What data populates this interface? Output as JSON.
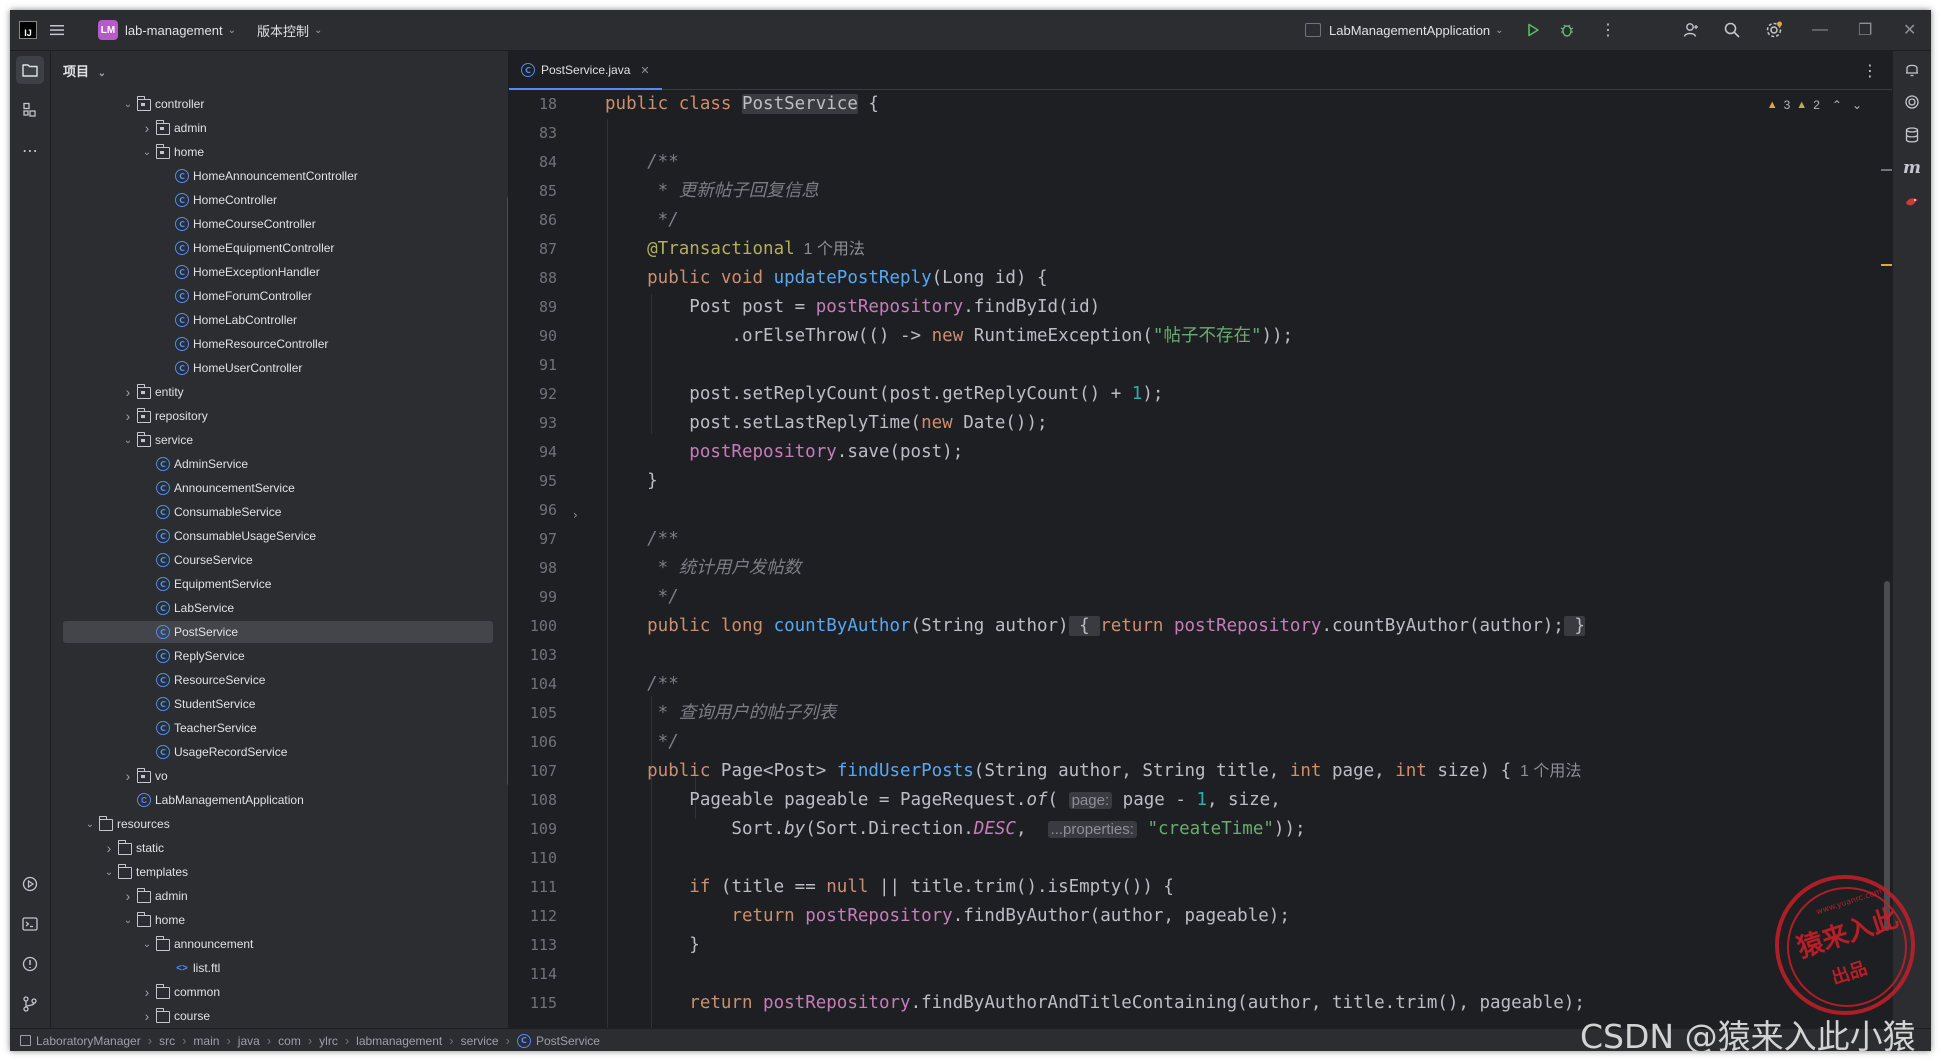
{
  "titlebar": {
    "project_badge": "LM",
    "project_name": "lab-management",
    "vcs_label": "版本控制",
    "run_config": "LabManagementApplication"
  },
  "project_panel": {
    "title": "项目",
    "tree": [
      {
        "label": "controller",
        "depth": 3,
        "type": "package",
        "expanded": true
      },
      {
        "label": "admin",
        "depth": 4,
        "type": "package",
        "expanded": false
      },
      {
        "label": "home",
        "depth": 4,
        "type": "package",
        "expanded": true
      },
      {
        "label": "HomeAnnouncementController",
        "depth": 5,
        "type": "class"
      },
      {
        "label": "HomeController",
        "depth": 5,
        "type": "class"
      },
      {
        "label": "HomeCourseController",
        "depth": 5,
        "type": "class"
      },
      {
        "label": "HomeEquipmentController",
        "depth": 5,
        "type": "class"
      },
      {
        "label": "HomeExceptionHandler",
        "depth": 5,
        "type": "class"
      },
      {
        "label": "HomeForumController",
        "depth": 5,
        "type": "class"
      },
      {
        "label": "HomeLabController",
        "depth": 5,
        "type": "class"
      },
      {
        "label": "HomeResourceController",
        "depth": 5,
        "type": "class"
      },
      {
        "label": "HomeUserController",
        "depth": 5,
        "type": "class"
      },
      {
        "label": "entity",
        "depth": 3,
        "type": "package",
        "expanded": false
      },
      {
        "label": "repository",
        "depth": 3,
        "type": "package",
        "expanded": false
      },
      {
        "label": "service",
        "depth": 3,
        "type": "package",
        "expanded": true
      },
      {
        "label": "AdminService",
        "depth": 4,
        "type": "class"
      },
      {
        "label": "AnnouncementService",
        "depth": 4,
        "type": "class"
      },
      {
        "label": "ConsumableService",
        "depth": 4,
        "type": "class"
      },
      {
        "label": "ConsumableUsageService",
        "depth": 4,
        "type": "class"
      },
      {
        "label": "CourseService",
        "depth": 4,
        "type": "class"
      },
      {
        "label": "EquipmentService",
        "depth": 4,
        "type": "class"
      },
      {
        "label": "LabService",
        "depth": 4,
        "type": "class"
      },
      {
        "label": "PostService",
        "depth": 4,
        "type": "class",
        "selected": true
      },
      {
        "label": "ReplyService",
        "depth": 4,
        "type": "class"
      },
      {
        "label": "ResourceService",
        "depth": 4,
        "type": "class"
      },
      {
        "label": "StudentService",
        "depth": 4,
        "type": "class"
      },
      {
        "label": "TeacherService",
        "depth": 4,
        "type": "class"
      },
      {
        "label": "UsageRecordService",
        "depth": 4,
        "type": "class"
      },
      {
        "label": "vo",
        "depth": 3,
        "type": "package",
        "expanded": false
      },
      {
        "label": "LabManagementApplication",
        "depth": 3,
        "type": "app"
      },
      {
        "label": "resources",
        "depth": 1,
        "type": "folder",
        "expanded": true
      },
      {
        "label": "static",
        "depth": 2,
        "type": "folder",
        "expanded": false
      },
      {
        "label": "templates",
        "depth": 2,
        "type": "folder",
        "expanded": true
      },
      {
        "label": "admin",
        "depth": 3,
        "type": "folder",
        "expanded": false
      },
      {
        "label": "home",
        "depth": 3,
        "type": "folder",
        "expanded": true
      },
      {
        "label": "announcement",
        "depth": 4,
        "type": "folder",
        "expanded": true
      },
      {
        "label": "list.ftl",
        "depth": 5,
        "type": "ftl"
      },
      {
        "label": "common",
        "depth": 4,
        "type": "folder",
        "expanded": false
      },
      {
        "label": "course",
        "depth": 4,
        "type": "folder",
        "expanded": false
      }
    ]
  },
  "editor": {
    "tab_label": "PostService.java",
    "warnings": "3",
    "weak_warnings": "2",
    "sticky": {
      "ln": "18",
      "tokens": [
        [
          "kw",
          "public class "
        ],
        [
          "hlname",
          "PostService"
        ],
        [
          "t",
          " {"
        ]
      ]
    },
    "lines": [
      {
        "ln": "83",
        "tokens": []
      },
      {
        "ln": "84",
        "tokens": [
          [
            "cmt",
            "    /**"
          ]
        ]
      },
      {
        "ln": "85",
        "tokens": [
          [
            "cmt",
            "     * 更新帖子回复信息"
          ]
        ]
      },
      {
        "ln": "86",
        "tokens": [
          [
            "cmt",
            "     */"
          ]
        ]
      },
      {
        "ln": "87",
        "tokens": [
          [
            "ann",
            "    @Transactional"
          ],
          [
            "usage",
            "  1 个用法"
          ]
        ]
      },
      {
        "ln": "88",
        "tokens": [
          [
            "kw",
            "    public void "
          ],
          [
            "fn",
            "updatePostReply"
          ],
          [
            "t",
            "(Long id) {"
          ]
        ]
      },
      {
        "ln": "89",
        "tokens": [
          [
            "t",
            "        Post post = "
          ],
          [
            "fld",
            "postRepository"
          ],
          [
            "t",
            ".findById(id)"
          ]
        ]
      },
      {
        "ln": "90",
        "tokens": [
          [
            "t",
            "            .orElseThrow(() -> "
          ],
          [
            "kw",
            "new "
          ],
          [
            "t",
            "RuntimeException("
          ],
          [
            "str",
            "\"帖子不存在\""
          ],
          [
            "t",
            "));"
          ]
        ]
      },
      {
        "ln": "91",
        "tokens": []
      },
      {
        "ln": "92",
        "tokens": [
          [
            "t",
            "        post.setReplyCount(post.getReplyCount() + "
          ],
          [
            "num",
            "1"
          ],
          [
            "t",
            ");"
          ]
        ]
      },
      {
        "ln": "93",
        "tokens": [
          [
            "t",
            "        post.setLastReplyTime("
          ],
          [
            "kw",
            "new "
          ],
          [
            "t",
            "Date());"
          ]
        ]
      },
      {
        "ln": "94",
        "tokens": [
          [
            "fld",
            "        postRepository"
          ],
          [
            "t",
            ".save(post);"
          ]
        ]
      },
      {
        "ln": "95",
        "tokens": [
          [
            "t",
            "    }"
          ]
        ]
      },
      {
        "ln": "96",
        "tokens": []
      },
      {
        "ln": "97",
        "tokens": [
          [
            "cmt",
            "    /**"
          ]
        ]
      },
      {
        "ln": "98",
        "tokens": [
          [
            "cmt",
            "     * 统计用户发帖数"
          ]
        ]
      },
      {
        "ln": "99",
        "tokens": [
          [
            "cmt",
            "     */"
          ]
        ]
      },
      {
        "ln": "100",
        "tokens": [
          [
            "kw",
            "    public long "
          ],
          [
            "fn",
            "countByAuthor"
          ],
          [
            "t",
            "(String author)"
          ],
          [
            "fold",
            " { "
          ],
          [
            "kw",
            "return "
          ],
          [
            "fld",
            "postRepository"
          ],
          [
            "t",
            ".countByAuthor(author);"
          ],
          [
            "fold",
            " }"
          ]
        ]
      },
      {
        "ln": "103",
        "tokens": []
      },
      {
        "ln": "104",
        "tokens": [
          [
            "cmt",
            "    /**"
          ]
        ]
      },
      {
        "ln": "105",
        "tokens": [
          [
            "cmt",
            "     * 查询用户的帖子列表"
          ]
        ]
      },
      {
        "ln": "106",
        "tokens": [
          [
            "cmt",
            "     */"
          ]
        ]
      },
      {
        "ln": "107",
        "tokens": [
          [
            "kw",
            "    public "
          ],
          [
            "t",
            "Page<Post> "
          ],
          [
            "fn",
            "findUserPosts"
          ],
          [
            "t",
            "(String author, String title, "
          ],
          [
            "kw",
            "int "
          ],
          [
            "t",
            "page, "
          ],
          [
            "kw",
            "int "
          ],
          [
            "t",
            "size) {"
          ],
          [
            "usage",
            "  1 个用法"
          ]
        ]
      },
      {
        "ln": "108",
        "tokens": [
          [
            "t",
            "        Pageable pageable = PageRequest."
          ],
          [
            "it",
            "of"
          ],
          [
            "t",
            "( "
          ],
          [
            "hint",
            "page:"
          ],
          [
            "t",
            " page - "
          ],
          [
            "num",
            "1"
          ],
          [
            "t",
            ", size,"
          ]
        ]
      },
      {
        "ln": "109",
        "tokens": [
          [
            "t",
            "            Sort."
          ],
          [
            "it",
            "by"
          ],
          [
            "t",
            "(Sort.Direction."
          ],
          [
            "itfld",
            "DESC"
          ],
          [
            "t",
            ",  "
          ],
          [
            "hint",
            "...properties:"
          ],
          [
            "t",
            " "
          ],
          [
            "str",
            "\"createTime\""
          ],
          [
            "t",
            "));"
          ]
        ]
      },
      {
        "ln": "110",
        "tokens": []
      },
      {
        "ln": "111",
        "tokens": [
          [
            "kw",
            "        if "
          ],
          [
            "t",
            "(title == "
          ],
          [
            "kw",
            "null "
          ],
          [
            "t",
            "|| title.trim().isEmpty()) {"
          ]
        ]
      },
      {
        "ln": "112",
        "tokens": [
          [
            "kw",
            "            return "
          ],
          [
            "fld",
            "postRepository"
          ],
          [
            "t",
            ".findByAuthor(author, pageable);"
          ]
        ]
      },
      {
        "ln": "113",
        "tokens": [
          [
            "t",
            "        }"
          ]
        ]
      },
      {
        "ln": "114",
        "tokens": []
      },
      {
        "ln": "115",
        "tokens": [
          [
            "kw",
            "        return "
          ],
          [
            "fld",
            "postRepository"
          ],
          [
            "t",
            ".findByAuthorAndTitleContaining(author, title.trim(), pageable);"
          ]
        ]
      }
    ]
  },
  "statusbar": {
    "breadcrumbs": [
      "LaboratoryManager",
      "src",
      "main",
      "java",
      "com",
      "ylrc",
      "labmanagement",
      "service",
      "PostService"
    ]
  },
  "watermark": {
    "csdn": "CSDN @猿来入此小猿",
    "stamp_main": "猿来入此",
    "stamp_sub": "出品",
    "stamp_url": "www.yuanrc.com"
  },
  "colors": {
    "keyword": "#cf8e6d",
    "function": "#56a8f5",
    "field": "#c77dbb",
    "number": "#2aacb8",
    "string": "#6aab73",
    "comment": "#7a7e85",
    "annotation": "#b3ae60",
    "accent": "#548af7"
  }
}
